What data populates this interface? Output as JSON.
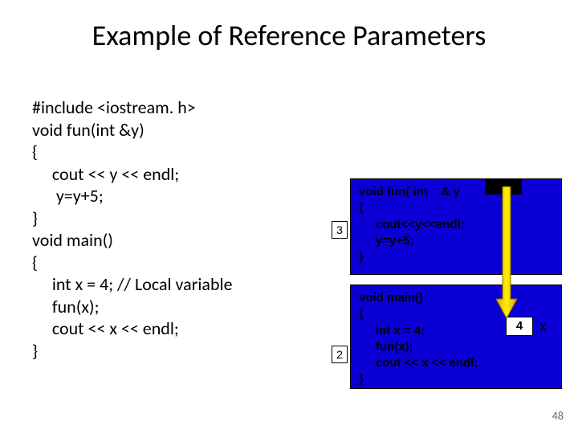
{
  "title": "Example of Reference Parameters",
  "code_left": "#include <iostream. h>\nvoid fun(int &y)\n{\n     cout << y << endl;\n      y=y+5;\n}\nvoid main()\n{\n     int x = 4; // Local variable\n     fun(x);\n     cout << x << endl;\n}",
  "box_top_code": "void fun( int    & y            )\n{\n     cout<<y<<endl;\n     y=y+5;\n}",
  "box_bot_code": "void main()\n{\n     int x = 4;\n     fun(x);\n     cout << x << endl;\n}",
  "label3": "3",
  "label2": "2",
  "whitebox_value": "4",
  "x_label": "x",
  "page_number": "48"
}
